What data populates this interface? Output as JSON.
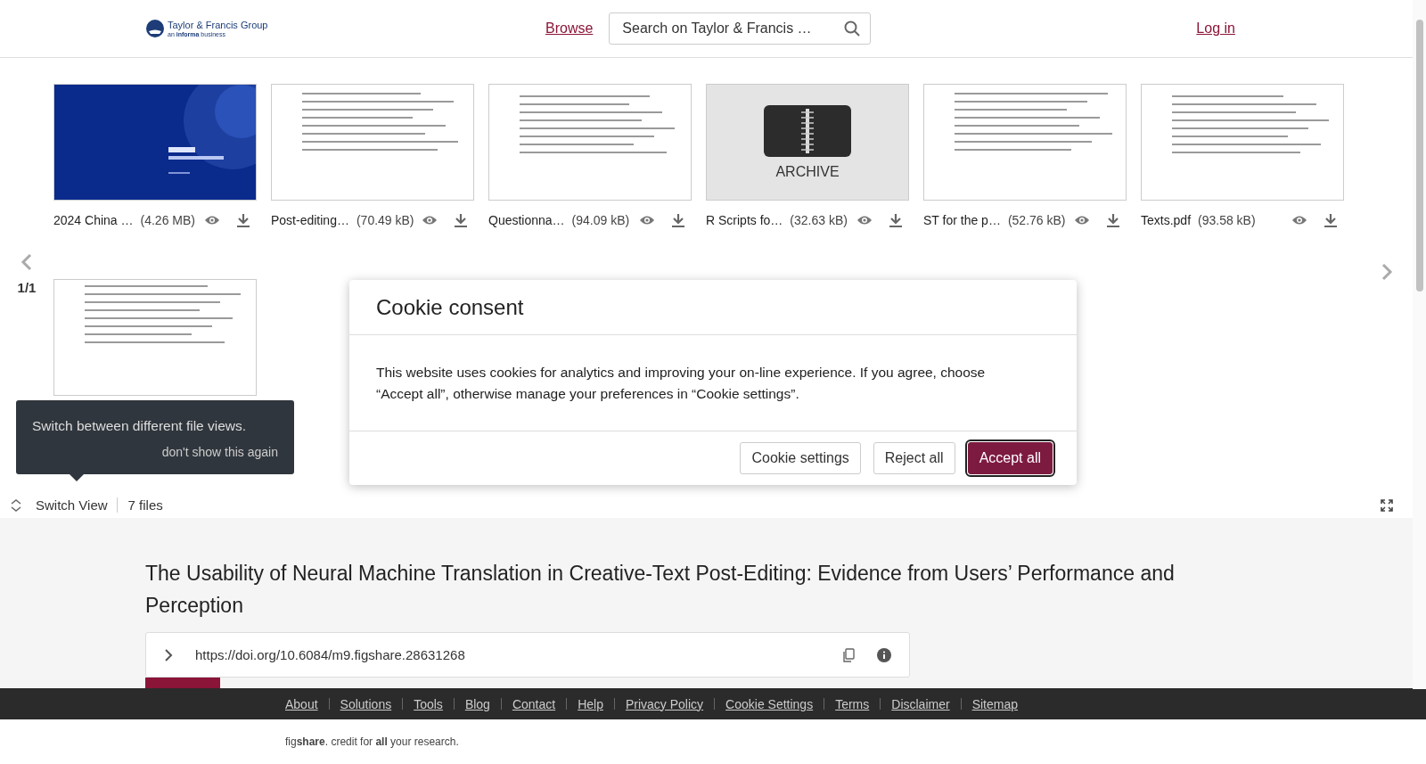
{
  "header": {
    "logo": {
      "name": "Taylor & Francis Group",
      "tagline": "an **informa** business"
    },
    "nav_link": "Browse",
    "search": {
      "placeholder": "Search on Taylor & Francis …"
    },
    "login": "Log in"
  },
  "files": [
    {
      "name": "2024 China …",
      "size": "(4.26 MB)",
      "kind": "cover"
    },
    {
      "name": "Post-editing…",
      "size": "(70.49 kB)",
      "kind": "document"
    },
    {
      "name": "Questionna…",
      "size": "(94.09 kB)",
      "kind": "document"
    },
    {
      "name": "R Scripts fo…",
      "size": "(32.63 kB)",
      "kind": "archive",
      "badge": "ARCHIVE"
    },
    {
      "name": "ST for the p…",
      "size": "(52.76 kB)",
      "kind": "document"
    },
    {
      "name": "Texts.pdf",
      "size": "(93.58 kB)",
      "kind": "document"
    },
    {
      "kind": "document"
    }
  ],
  "pager": "1/1",
  "tooltip": {
    "text": "Switch between different file views.",
    "dismiss": "don't show this again"
  },
  "view_bar": {
    "switch": "Switch View",
    "count": "7 files"
  },
  "title": "The Usability of Neural Machine Translation in Creative-Text Post-Editing: Evidence from Users’ Performance and Perception",
  "doi": "https://doi.org/10.6084/m9.figshare.28631268",
  "footer_links": [
    "About",
    "Solutions",
    "Tools",
    "Blog",
    "Contact",
    "Help",
    "Privacy Policy",
    "Cookie Settings",
    "Terms",
    "Disclaimer",
    "Sitemap"
  ],
  "credit": "fig**share**. credit for **all** your research.",
  "cookie_dialog": {
    "title": "Cookie consent",
    "text": "This website uses cookies for analytics and improving your on-line experience. If you agree, choose “Accept all”, otherwise manage your preferences in “Cookie settings”.",
    "buttons": [
      {
        "label": "Cookie settings",
        "primary": false
      },
      {
        "label": "Reject all",
        "primary": false
      },
      {
        "label": "Accept all",
        "primary": true
      }
    ]
  }
}
